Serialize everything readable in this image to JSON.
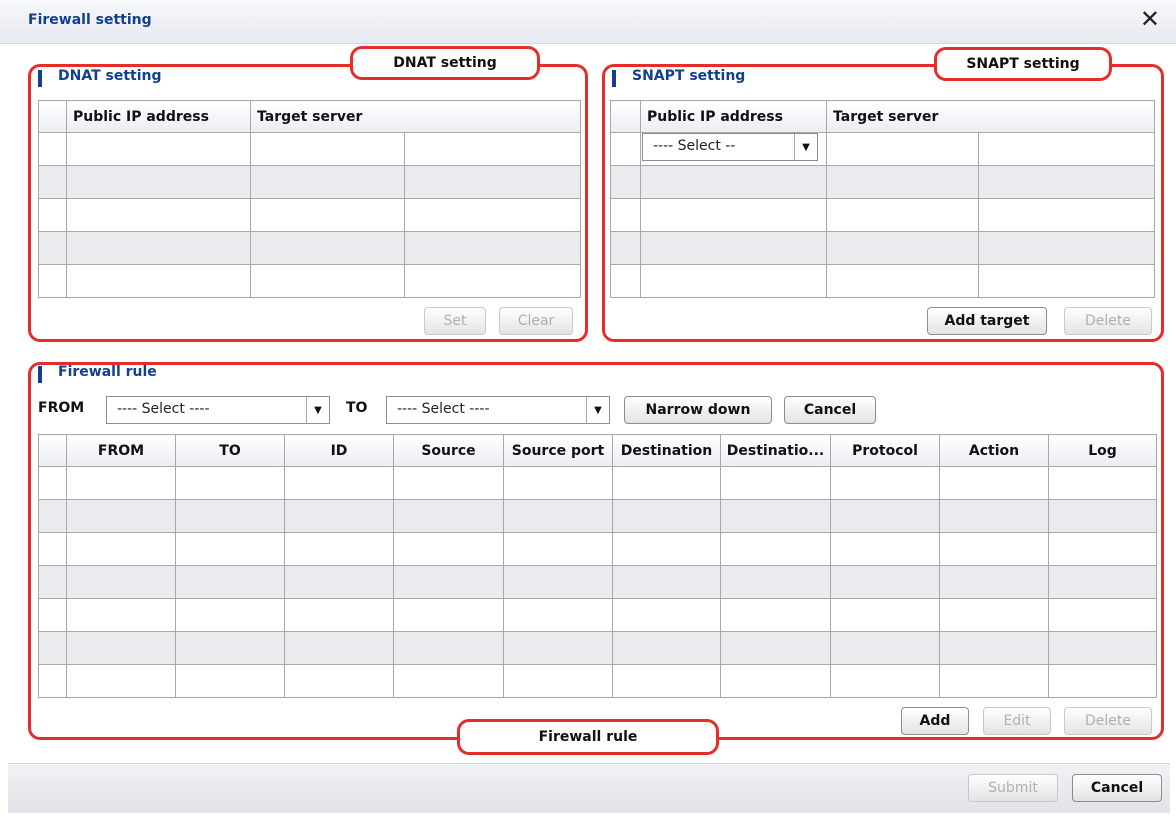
{
  "window": {
    "title": "Firewall setting",
    "close_glyph": "✕"
  },
  "dnat": {
    "section_label": "DNAT setting",
    "callout": "DNAT setting",
    "columns": [
      "Public IP address",
      "Target server"
    ],
    "set_label": "Set",
    "clear_label": "Clear"
  },
  "snapt": {
    "section_label": "SNAPT setting",
    "callout": "SNAPT setting",
    "columns": [
      "Public IP address",
      "Target server"
    ],
    "select_value": "---- Select --",
    "add_target_label": "Add target",
    "delete_label": "Delete"
  },
  "firewall": {
    "section_label": "Firewall rule",
    "callout": "Firewall rule",
    "from_label": "FROM",
    "to_label": "TO",
    "from_select": "---- Select ----",
    "to_select": "---- Select ----",
    "narrow_label": "Narrow down",
    "cancel_label": "Cancel",
    "columns": [
      "FROM",
      "TO",
      "ID",
      "Source",
      "Source port",
      "Destination",
      "Destinatio...",
      "Protocol",
      "Action",
      "Log"
    ],
    "add_label": "Add",
    "edit_label": "Edit",
    "delete_label": "Delete"
  },
  "footer": {
    "submit_label": "Submit",
    "cancel_label": "Cancel"
  },
  "colors": {
    "accent": "#123f8e",
    "highlight": "#e52d2a",
    "row_alt": "#e9ebef"
  }
}
